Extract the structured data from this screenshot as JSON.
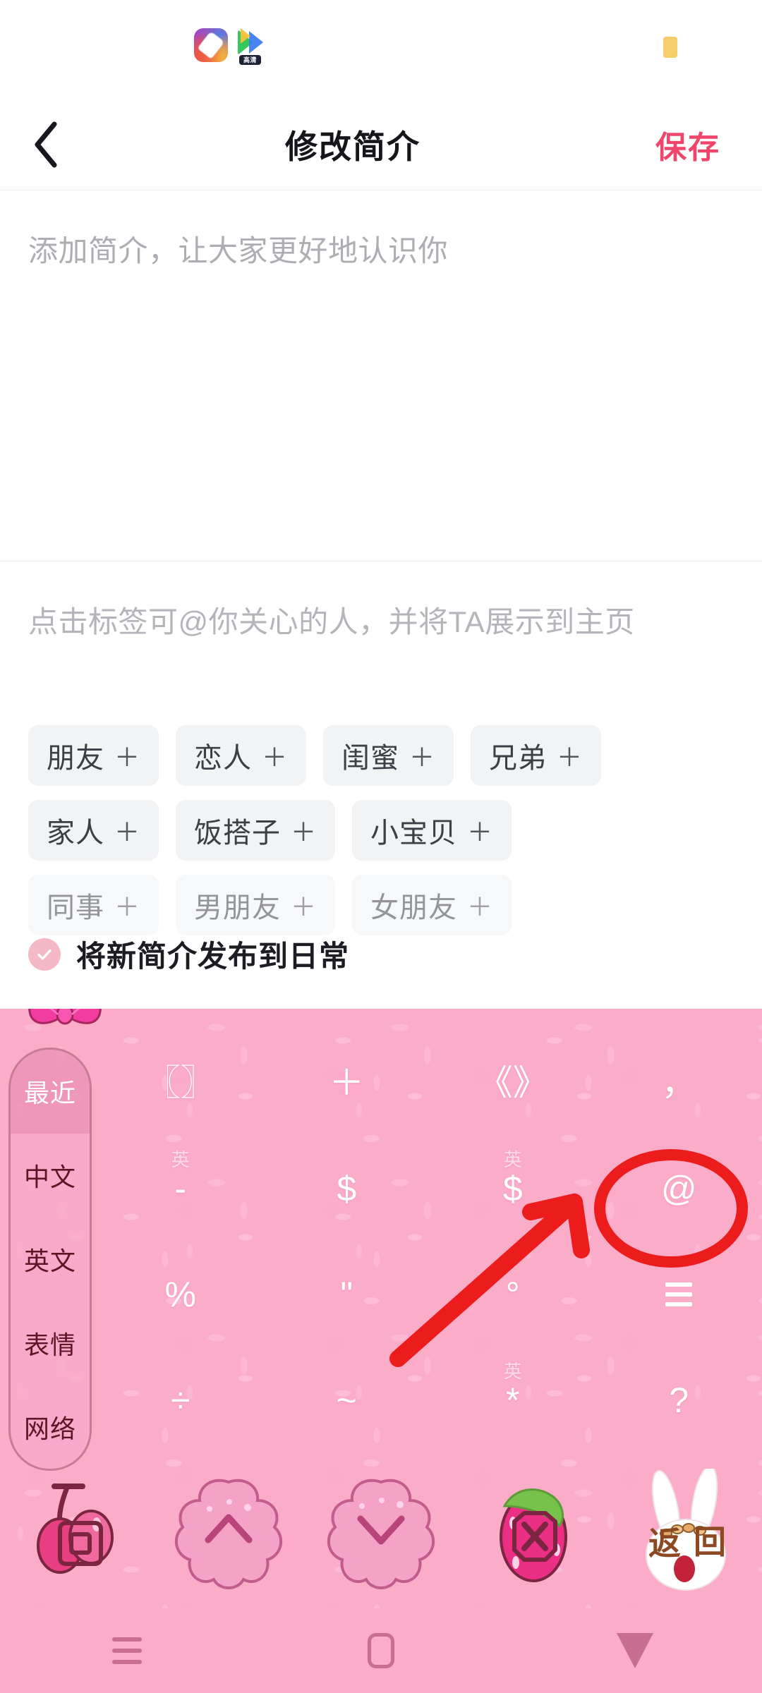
{
  "status_bar": {
    "icons": [
      {
        "name": "paint-app-icon"
      },
      {
        "name": "video-player-app-icon",
        "badge": "高清"
      }
    ],
    "battery": {
      "name": "battery-icon",
      "color": "#f7cd6b"
    }
  },
  "header": {
    "back_icon": "chevron-left-icon",
    "title": "修改简介",
    "save_label": "保存",
    "save_color": "#f0456b"
  },
  "bio": {
    "value": "",
    "placeholder": "添加简介，让大家更好地认识你"
  },
  "tags": {
    "hint": "点击标签可@你关心的人，并将TA展示到主页",
    "plus": "＋",
    "rows": [
      [
        {
          "label": "朋友"
        },
        {
          "label": "恋人"
        },
        {
          "label": "闺蜜"
        },
        {
          "label": "兄弟"
        }
      ],
      [
        {
          "label": "家人"
        },
        {
          "label": "饭搭子"
        },
        {
          "label": "小宝贝"
        }
      ],
      [
        {
          "label": "同事"
        },
        {
          "label": "男朋友"
        },
        {
          "label": "女朋友"
        }
      ]
    ]
  },
  "publish": {
    "checked": true,
    "label": "将新简介发布到日常",
    "check_color": "#f5b8c6"
  },
  "keyboard": {
    "theme_color": "#fbacc9",
    "bow_icon": "pink-bow-icon",
    "tabs": [
      {
        "label": "最近",
        "active": true
      },
      {
        "label": "中文",
        "active": false
      },
      {
        "label": "英文",
        "active": false
      },
      {
        "label": "表情",
        "active": false
      },
      {
        "label": "网络",
        "active": false
      }
    ],
    "keys": [
      {
        "sym": "〖〗",
        "sub": "",
        "name": "bracket-key"
      },
      {
        "sym": "＋",
        "sub": "",
        "name": "plus-key"
      },
      {
        "sym": "《》",
        "sub": "",
        "name": "angle-bracket-key"
      },
      {
        "sym": "，",
        "sub": "",
        "name": "comma-key"
      },
      {
        "sym": "-",
        "sub": "英",
        "name": "hyphen-key"
      },
      {
        "sym": "$",
        "sub": "",
        "name": "dollar-key"
      },
      {
        "sym": "$",
        "sub": "英",
        "name": "dollar-en-key"
      },
      {
        "sym": "@",
        "sub": "",
        "name": "at-sign-key"
      },
      {
        "sym": "%",
        "sub": "",
        "name": "percent-key"
      },
      {
        "sym": "\"",
        "sub": "",
        "name": "quote-key"
      },
      {
        "sym": "°",
        "sub": "",
        "name": "degree-key"
      },
      {
        "sym": "",
        "sub": "",
        "name": "more-symbols-key"
      },
      {
        "sym": "÷",
        "sub": "",
        "name": "divide-key"
      },
      {
        "sym": "~",
        "sub": "",
        "name": "tilde-key"
      },
      {
        "sym": "*",
        "sub": "英",
        "name": "asterisk-key"
      },
      {
        "sym": "?",
        "sub": "",
        "name": "question-mark-key"
      }
    ],
    "functions": [
      {
        "name": "enter-key",
        "label": "回"
      },
      {
        "name": "page-up-key",
        "label": "∧"
      },
      {
        "name": "page-down-key",
        "label": "∨"
      },
      {
        "name": "delete-key",
        "label": "✕"
      },
      {
        "name": "return-key",
        "label": "返回"
      }
    ]
  },
  "annotation": {
    "color": "#ec1c1c",
    "circle_target": "at-sign-key",
    "arrow": "arrow-pointing-to-at-key"
  },
  "android_nav": {
    "buttons": [
      {
        "name": "recents-button",
        "icon": "menu-icon"
      },
      {
        "name": "home-button",
        "icon": "square-icon"
      },
      {
        "name": "back-button",
        "icon": "triangle-down-icon"
      }
    ]
  }
}
